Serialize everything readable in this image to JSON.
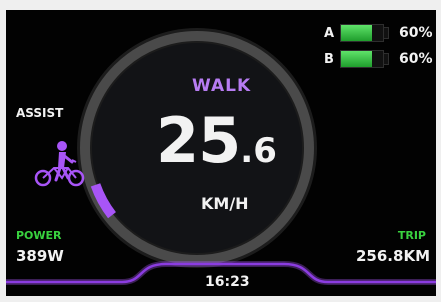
{
  "battery": [
    {
      "letter": "A",
      "percent": "60%",
      "level": 0.6
    },
    {
      "letter": "B",
      "percent": "60%",
      "level": 0.6
    }
  ],
  "mode": {
    "label": "WALK"
  },
  "speed": {
    "integer": "25",
    "decimal": ".6",
    "unit": "KM/H"
  },
  "assist": {
    "label": "ASSIST",
    "icon": "bicycle-walk-icon"
  },
  "power": {
    "label": "POWER",
    "value": "389W"
  },
  "trip": {
    "label": "TRIP",
    "value": "256.8KM"
  },
  "clock": {
    "time": "16:23"
  },
  "colors": {
    "accent": "#a855f7",
    "ring": "#4a4a4a",
    "green": "#39d23f",
    "background": "#020202"
  }
}
